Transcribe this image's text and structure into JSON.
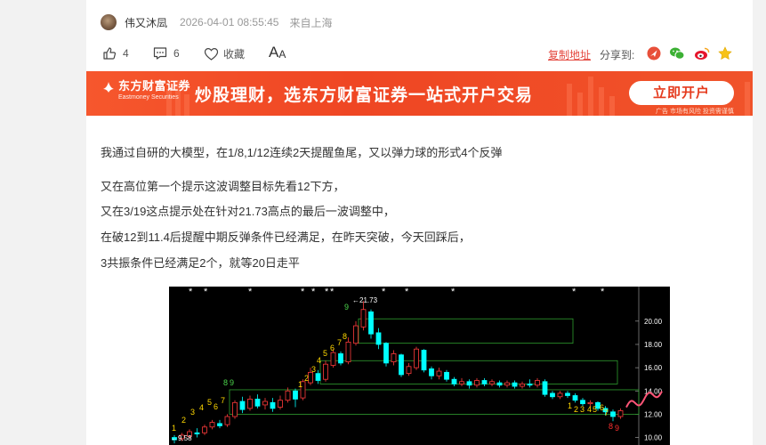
{
  "post": {
    "author": "伟又沐凨",
    "timestamp": "2026-04-01 08:55:45",
    "location": "来自上海"
  },
  "toolbar": {
    "likes": "4",
    "comments": "6",
    "favorite_label": "收藏",
    "font_size_label_big": "A",
    "font_size_label_small": "A",
    "copy_link_label": "复制地址",
    "share_label": "分享到:",
    "share_icons": [
      "toutiao-icon",
      "wechat-icon",
      "weibo-icon",
      "star-icon"
    ]
  },
  "banner": {
    "logo_cn": "东方财富证券",
    "logo_en": "Eastmoney Securities",
    "slogan": "炒股理财，选东方财富证券一站式开户交易",
    "cta_label": "立即开户",
    "ad_note": "广告  市场有风险 投资需谨慎",
    "colors": {
      "background": "#ef4623",
      "cta_text": "#e53b1e"
    }
  },
  "article": {
    "paragraphs": [
      "我通过自研的大模型，在1/8,1/12连续2天提醒鱼尾，又以弹力球的形式4个反弹",
      "又在高位第一个提示这波调整目标先看12下方，",
      "又在3/19这点提示处在针对21.73高点的最后一波调整中，",
      "在破12到11.4后提醒中期反弹条件已经满足，在昨天突破，今天回踩后，",
      "3共振条件已经满足2个，就等20日走平"
    ]
  },
  "chart_data": {
    "type": "candlestick",
    "y_ticks": [
      "20.00",
      "18.00",
      "16.00",
      "14.00",
      "12.00",
      "10.00"
    ],
    "ylim": [
      9.2,
      21.9
    ],
    "annotations": {
      "high": "←21.73",
      "low": "←9.58"
    },
    "countdown_labels": [
      "1",
      "2",
      "3",
      "4",
      "5",
      "6",
      "7",
      "8",
      "9",
      "1",
      "2",
      "3",
      "4",
      "5",
      "6",
      "7",
      "8",
      "9",
      "1",
      "2",
      "3",
      "4",
      "5",
      "6",
      "7",
      "8",
      "9"
    ],
    "star_markers": [
      "*",
      "*",
      "*",
      "*",
      "*",
      "*",
      "*",
      "*",
      "*",
      "*",
      "*",
      "*"
    ],
    "colors": {
      "up": "#ff3b3b",
      "down": "#00ffff",
      "box": "#2f9e2f",
      "label_yellow": "#ffd800",
      "label_green": "#4cd64c",
      "label_red": "#ff3030",
      "forecast": "#ff5577",
      "grid": "#b0b0b0"
    }
  }
}
